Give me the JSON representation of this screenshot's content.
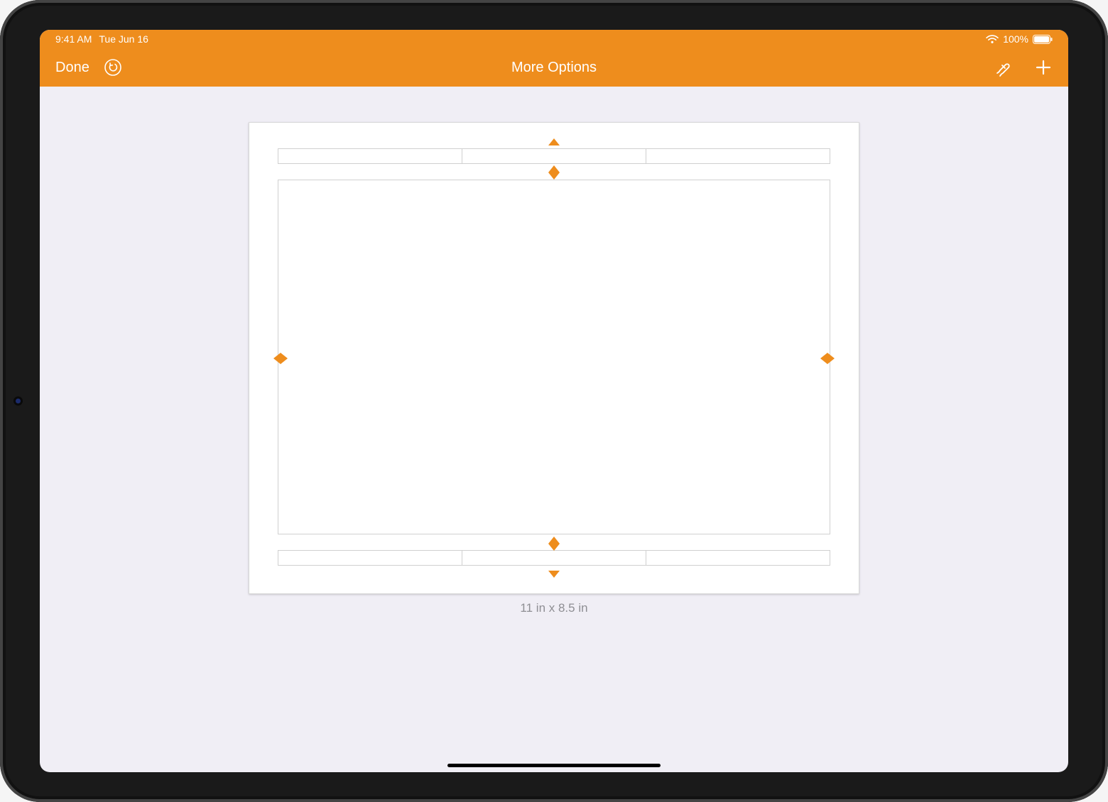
{
  "status": {
    "time": "9:41 AM",
    "date": "Tue Jun 16",
    "battery_text": "100%"
  },
  "toolbar": {
    "done_label": "Done",
    "title": "More Options"
  },
  "page": {
    "size_label": "11 in x 8.5 in"
  },
  "colors": {
    "accent": "#ee8d1d"
  }
}
